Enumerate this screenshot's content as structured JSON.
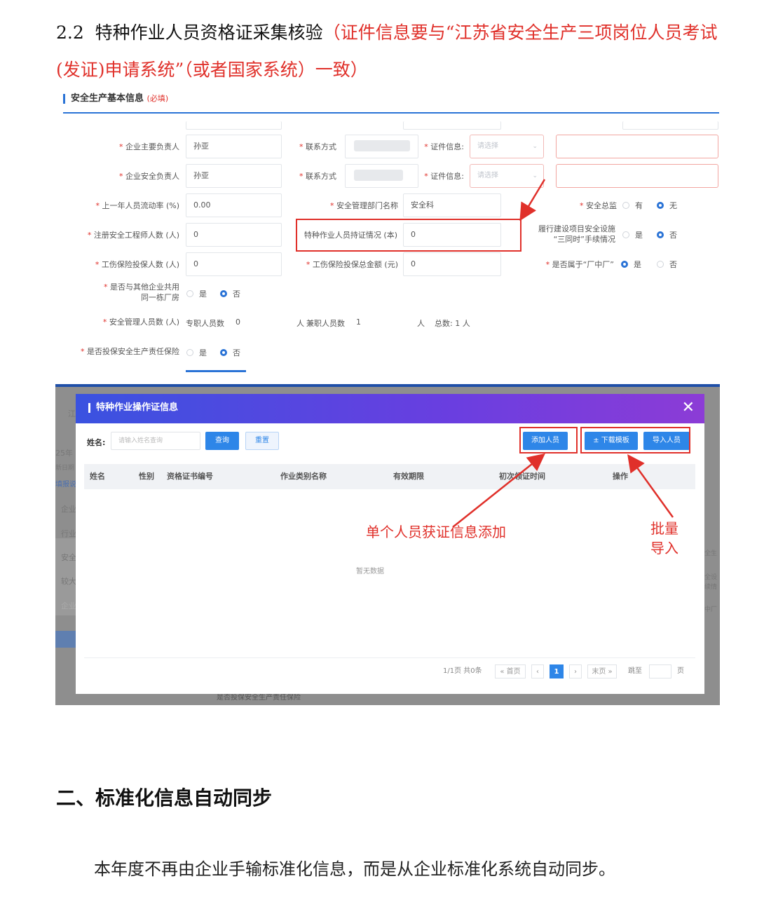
{
  "heading": {
    "number": "2.2",
    "title": "特种作业人员资格证采集核验",
    "note": "（证件信息要与“江苏省安全生产三项岗位人员考试(发证)申请系统”（或者国家系统）一致）"
  },
  "form": {
    "section_title": "安全生产基本信息",
    "section_required": "(必填)",
    "rows": {
      "main_person_label": "企业主要负责人",
      "main_person_value": "孙亚",
      "safety_person_label": "企业安全负责人",
      "safety_person_value": "孙亚",
      "contact_label": "联系方式",
      "cert_info_label": "证件信息:",
      "select_placeholder": "请选择",
      "turnover_label": "上一年人员流动率 (%)",
      "turnover_value": "0.00",
      "dept_label": "安全管理部门名称",
      "dept_value": "安全科",
      "director_label": "安全总监",
      "director_opt_yes": "有",
      "director_opt_no": "无",
      "engineer_label": "注册安全工程师人数 (人)",
      "engineer_value": "0",
      "special_label": "特种作业人员持证情况 (本)",
      "special_value": "0",
      "three_sim_label_1": "履行建设项目安全设施",
      "three_sim_label_2": "“三同时”手续情况",
      "opt_yes": "是",
      "opt_no": "否",
      "injury_count_label": "工伤保险投保人数 (人)",
      "injury_count_value": "0",
      "injury_amount_label": "工伤保险投保总金额 (元)",
      "injury_amount_value": "0",
      "factory_label": "是否属于“厂中厂”",
      "shared_label_1": "是否与其他企业共用",
      "shared_label_2": "同一栋厂房",
      "mgmt_label": "安全管理人员数 (人)",
      "fulltime_label": "专职人员数",
      "fulltime_value": "0",
      "unit_person": "人",
      "parttime_label": "兼职人员数",
      "parttime_value": "1",
      "total_text": "总数: 1 人",
      "liability_label": "是否投保安全生产责任保险"
    }
  },
  "dialog": {
    "title": "特种作业操作证信息",
    "name_label": "姓名:",
    "name_placeholder": "请输入姓名查询",
    "query_btn": "查询",
    "reset_btn": "重置",
    "add_btn": "添加人员",
    "download_btn": "± 下载模板",
    "import_btn": "导入人员",
    "columns": [
      "姓名",
      "性别",
      "资格证书编号",
      "作业类别名称",
      "有效期限",
      "初次领证时间",
      "操作"
    ],
    "empty_text": "暂无数据",
    "pager": {
      "summary": "1/1页 共0条",
      "first": "« 首页",
      "prev": "‹",
      "current": "1",
      "next": "›",
      "last": "末页 »",
      "jump": "跳至",
      "page_unit": "页"
    },
    "bg_text": [
      "江",
      "25年",
      "新日期",
      "填报说",
      "企业",
      "行业",
      "安全",
      "较大",
      "企业",
      "全生",
      "全设",
      "续情",
      "中厂"
    ],
    "bg_bottom_text": "是否投保安全生产责任保险"
  },
  "annotations": {
    "single": "单个人员获证信息添加",
    "batch_1": "批量",
    "batch_2": "导入"
  },
  "section2": {
    "heading": "二、标准化信息自动同步",
    "paragraph": "本年度不再由企业手输标准化信息，而是从企业标准化系统自动同步。"
  },
  "colors": {
    "accent": "#2a73d6",
    "red": "#e0302a",
    "dialog_gradient_start": "#3a52e0",
    "dialog_gradient_end": "#8c3cd6"
  }
}
